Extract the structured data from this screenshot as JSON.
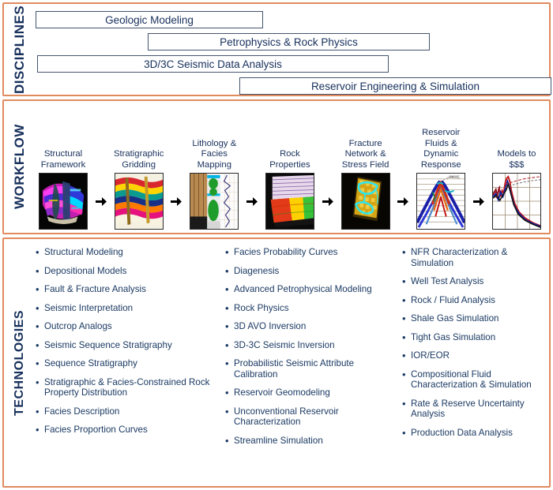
{
  "colors": {
    "panel_border": "#e08a5e",
    "bar_border": "#44556e",
    "text_navy": "#17305c",
    "tech_text": "#1b3a63",
    "background": "#ffffff"
  },
  "disciplines": {
    "section_label": "DISCIPLINES",
    "bars": [
      {
        "label": "Geologic Modeling"
      },
      {
        "label": "Petrophysics & Rock Physics"
      },
      {
        "label": "3D/3C Seismic Data Analysis"
      },
      {
        "label": "Reservoir Engineering & Simulation"
      }
    ]
  },
  "workflow": {
    "section_label": "WORKFLOW",
    "arrow_icon": "arrow-right-icon",
    "steps": [
      {
        "label": "Structural\nFramework",
        "thumb": "structural-framework-thumbnail"
      },
      {
        "label": "Stratigraphic\nGridding",
        "thumb": "stratigraphic-gridding-thumbnail"
      },
      {
        "label": "Lithology &\nFacies\nMapping",
        "thumb": "lithology-facies-mapping-thumbnail"
      },
      {
        "label": "Rock\nProperties",
        "thumb": "rock-properties-thumbnail"
      },
      {
        "label": "Fracture\nNetwork &\nStress Field",
        "thumb": "fracture-network-thumbnail"
      },
      {
        "label": "Reservoir\nFluids &\nDynamic\nResponse",
        "thumb": "reservoir-fluids-thumbnail"
      },
      {
        "label": "Models to\n$$$",
        "thumb": "models-to-money-thumbnail"
      }
    ]
  },
  "technologies": {
    "section_label": "TECHNOLOGIES",
    "bullet": "•",
    "columns": [
      [
        "Structural Modeling",
        "Depositional Models",
        "Fault & Fracture Analysis",
        "Seismic Interpretation",
        "Outcrop Analogs",
        "Seismic Sequence Stratigraphy",
        "Sequence Stratigraphy",
        "Stratigraphic & Facies-Constrained Rock Property Distribution",
        "Facies Description",
        "Facies Proportion Curves"
      ],
      [
        "Facies Probability Curves",
        "Diagenesis",
        "Advanced Petrophysical Modeling",
        "Rock Physics",
        "3D AVO Inversion",
        "3D-3C Seismic Inversion",
        "Probabilistic Seismic Attribute Calibration",
        "Reservoir Geomodeling",
        "Unconventional Reservoir Characterization",
        "Streamline Simulation"
      ],
      [
        "NFR Characterization & Simulation",
        "Well Test Analysis",
        "Rock / Fluid Analysis",
        "Shale Gas Simulation",
        "Tight Gas Simulation",
        "IOR/EOR",
        "Compositional Fluid Characterization & Simulation",
        "Rate & Reserve Uncertainty Analysis",
        "Production Data Analysis"
      ]
    ]
  }
}
